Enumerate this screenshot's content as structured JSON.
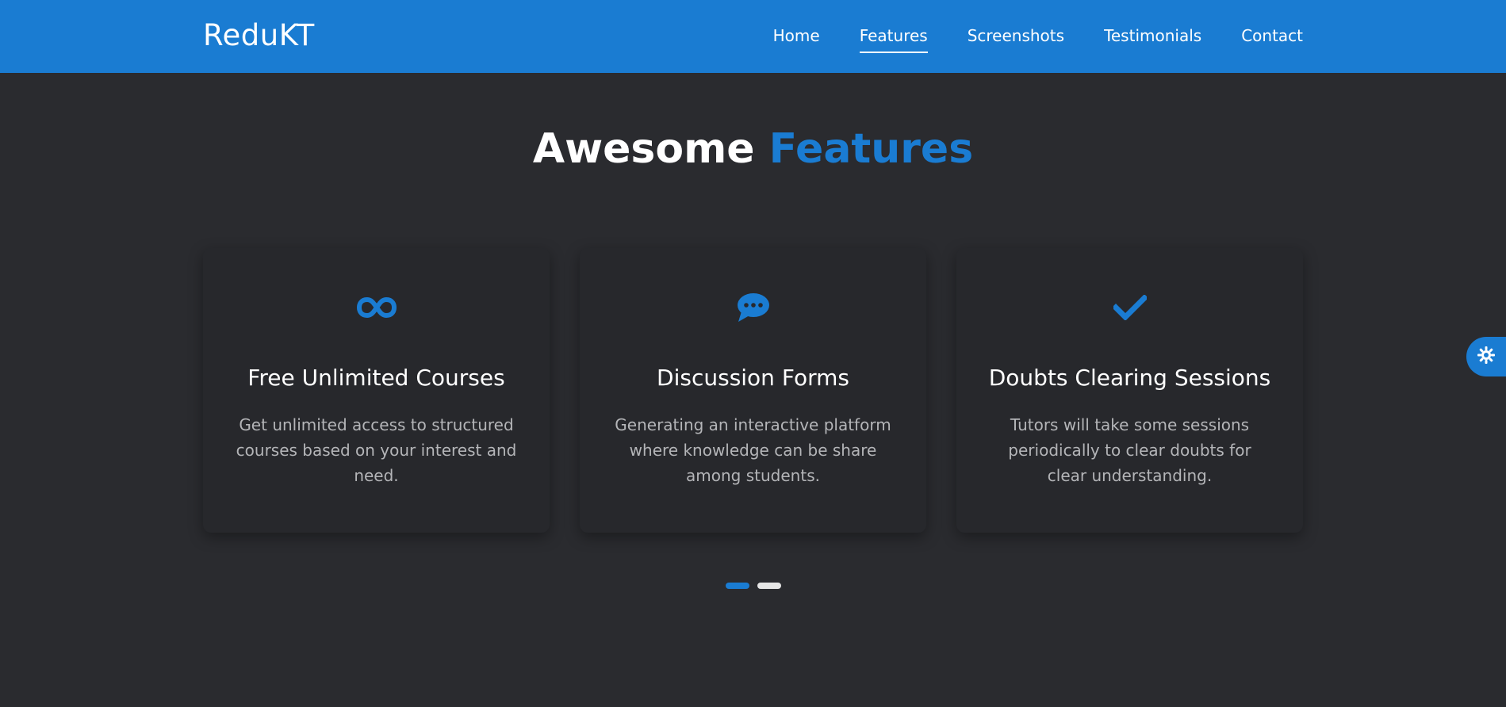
{
  "navbar": {
    "brand": "ReduKT",
    "links": [
      {
        "label": "Home",
        "active": false
      },
      {
        "label": "Features",
        "active": true
      },
      {
        "label": "Screenshots",
        "active": false
      },
      {
        "label": "Testimonials",
        "active": false
      },
      {
        "label": "Contact",
        "active": false
      }
    ]
  },
  "section": {
    "title_part1": "Awesome",
    "title_part2": "Features"
  },
  "cards": [
    {
      "icon": "infinity-icon",
      "title": "Free Unlimited Courses",
      "text": "Get unlimited access to structured courses based on your interest and need."
    },
    {
      "icon": "chat-bubble-icon",
      "title": "Discussion Forms",
      "text": "Generating an interactive platform where knowledge can be share among students."
    },
    {
      "icon": "checkmark-icon",
      "title": "Doubts Clearing Sessions",
      "text": "Tutors will take some sessions periodically to clear doubts for clear understanding."
    }
  ],
  "carousel": {
    "pages": 2,
    "active_index": 0
  },
  "theme_toggle": {
    "icon": "sun-gear-icon"
  },
  "colors": {
    "accent": "#1a7cd2",
    "background": "#2a2b2f",
    "card": "#27282c"
  }
}
